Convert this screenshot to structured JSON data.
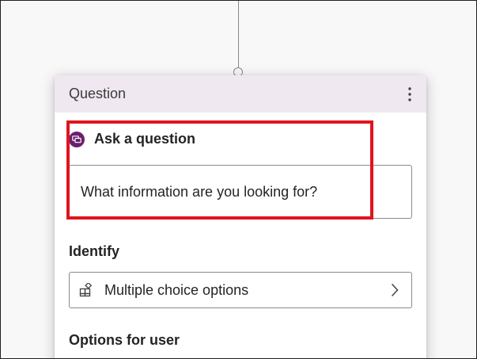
{
  "node": {
    "header_title": "Question",
    "more_options_icon": "more-vertical-icon",
    "ask_section": {
      "icon": "chat-bubble-icon",
      "label": "Ask a question",
      "input_value": "What information are you looking for?"
    },
    "identify_section": {
      "label": "Identify",
      "select_icon": "choice-grid-icon",
      "select_value": "Multiple choice options",
      "chevron_icon": "chevron-right-icon"
    },
    "options_section": {
      "label": "Options for user"
    }
  },
  "colors": {
    "header_background": "#efe8f0",
    "badge_purple": "#6b1f6e",
    "highlight_red": "#e0141e"
  }
}
